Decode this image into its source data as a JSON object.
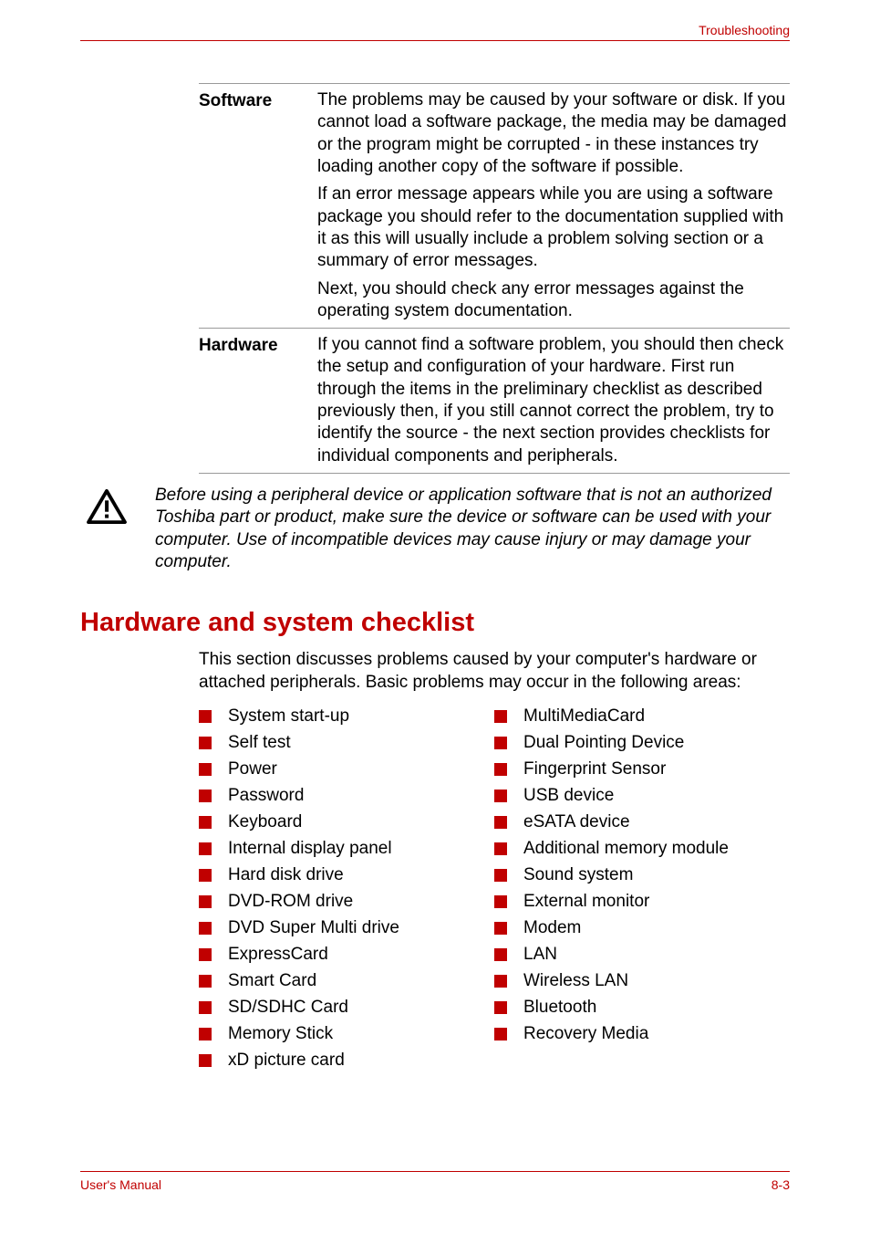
{
  "header": {
    "section_title": "Troubleshooting"
  },
  "table": {
    "rows": [
      {
        "label": "Software",
        "paragraphs": [
          "The problems may be caused by your software or disk. If you cannot load a software package, the media may be damaged or the program might be corrupted - in these instances try loading another copy of the software if possible.",
          "If an error message appears while you are using a software package you should refer to the documentation supplied with it as this will usually include a problem solving section or a summary of error messages.",
          "Next, you should check any error messages against the operating system documentation."
        ]
      },
      {
        "label": "Hardware",
        "paragraphs": [
          "If you cannot find a software problem, you should then check the setup and configuration of your hardware. First run through the items in the preliminary checklist as described previously then, if you still cannot correct the problem, try to identify the source - the next section provides checklists for individual components and peripherals."
        ]
      }
    ]
  },
  "caution": {
    "icon_name": "caution-icon",
    "text": "Before using a peripheral device or application software that is not an authorized Toshiba part or product, make sure the device or software can be used with your computer. Use of incompatible devices may cause injury or may damage your computer."
  },
  "section": {
    "heading": "Hardware and system checklist",
    "intro": "This section discusses problems caused by your computer's hardware or attached peripherals. Basic problems may occur in the following areas:",
    "left_items": [
      "System start-up",
      "Self test",
      "Power",
      "Password",
      "Keyboard",
      "Internal display panel",
      "Hard disk drive",
      "DVD-ROM drive",
      "DVD Super Multi drive",
      "ExpressCard",
      "Smart Card",
      "SD/SDHC Card",
      "Memory Stick",
      "xD picture card"
    ],
    "right_items": [
      "MultiMediaCard",
      "Dual Pointing Device",
      "Fingerprint Sensor",
      "USB device",
      "eSATA device",
      "Additional memory module",
      "Sound system",
      "External monitor",
      "Modem",
      "LAN",
      "Wireless LAN",
      "Bluetooth",
      "Recovery Media"
    ]
  },
  "footer": {
    "left": "User's Manual",
    "right": "8-3"
  }
}
